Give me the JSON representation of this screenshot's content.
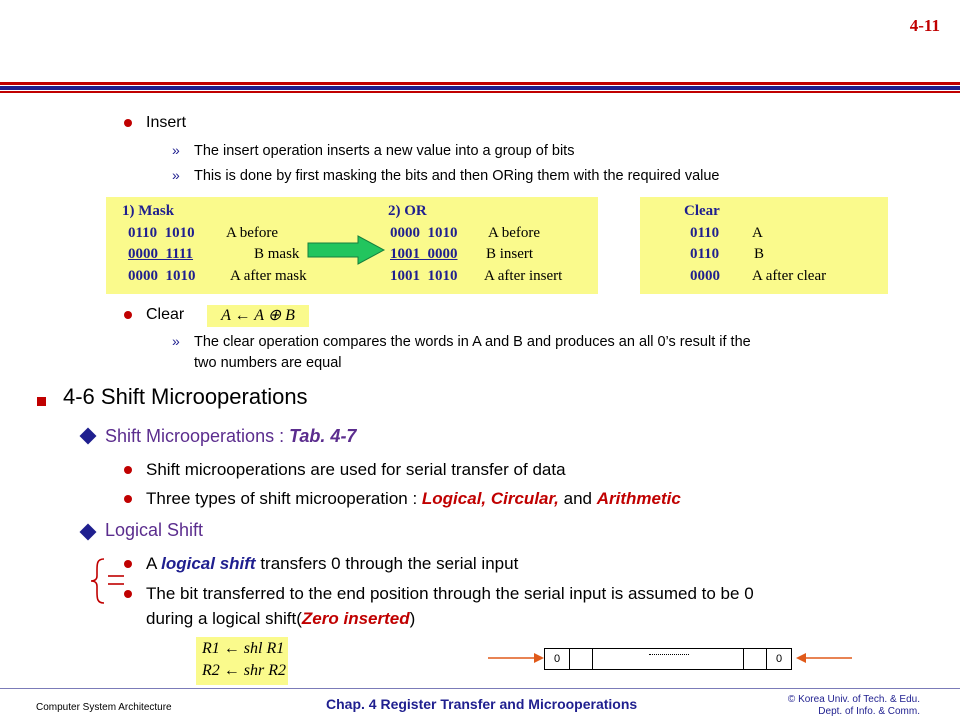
{
  "page_number": "4-11",
  "insert": {
    "title": "Insert",
    "lines": [
      "The insert operation inserts a new value into a group of bits",
      "This is done by first masking the bits and then ORing them with the required value"
    ]
  },
  "mask_box": {
    "header": "1) Mask",
    "r1_bits": "0110  1010",
    "r1_label": "A before",
    "r2_bits": "0000  1111",
    "r2_label": "B mask",
    "r3_bits": "0000  1010",
    "r3_label": "A after mask"
  },
  "or_box": {
    "header": "2) OR",
    "r1_bits": "0000  1010",
    "r1_label": "A before",
    "r2_bits": "1001  0000",
    "r2_label": "B insert",
    "r3_bits": "1001  1010",
    "r3_label": "A after insert"
  },
  "clear_box": {
    "header": "Clear",
    "r1_bits": "0110",
    "r1_label": "A",
    "r2_bits": "0110",
    "r2_label": "B",
    "r3_bits": "0000",
    "r3_label": "A after clear"
  },
  "clear": {
    "title": "Clear",
    "formula": "A ← A ⊕ B",
    "line1": "The clear operation compares the words in A and B and produces an all 0’s result if the",
    "line2": "two numbers are equal"
  },
  "section": {
    "title": "4-6  Shift Microoperations"
  },
  "shift_micro": {
    "label": "Shift Microoperations",
    "sep": " : ",
    "ref": "Tab. 4-7",
    "b1": "Shift microoperations are used for serial transfer of data",
    "b2_pre": "Three types of shift microoperation : ",
    "b2_logical": "Logical, Circular,",
    "b2_and": " and ",
    "b2_arith": "Arithmetic"
  },
  "logical_shift": {
    "label": "Logical Shift",
    "b1_pre": "A ",
    "b1_em": "logical shift",
    "b1_post": " transfers 0 through the serial input",
    "b2_line1": "The bit transferred to the end position through the serial input is assumed to be 0",
    "b2_pre": "during a logical shift(",
    "b2_em": "Zero inserted",
    "b2_post": ")"
  },
  "shift_formulas": {
    "shl": "R1 ← shl R1",
    "shr": "R2 ← shr R2"
  },
  "register": {
    "left_bit": "0",
    "right_bit": "0"
  },
  "footer": {
    "left": "Computer System Architecture",
    "center": "Chap. 4  Register Transfer and Microoperations",
    "right1": "© Korea Univ. of Tech. & Edu.",
    "right2": "Dept. of Info. & Comm."
  }
}
